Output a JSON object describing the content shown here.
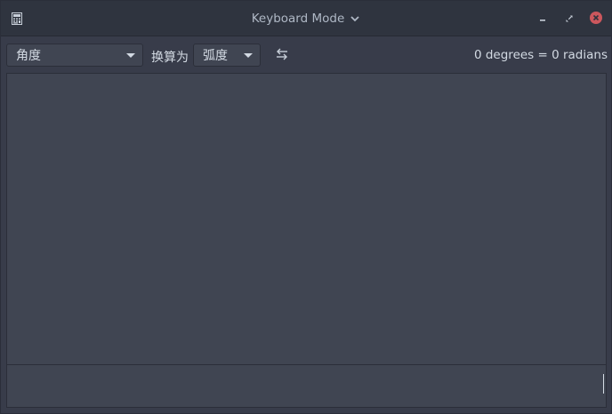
{
  "window": {
    "title": "Keyboard Mode",
    "app_icon": "calculator-icon",
    "controls": {
      "minimize_icon": "minimize-icon",
      "maximize_icon": "restore-icon",
      "close_icon": "close-icon"
    }
  },
  "converter": {
    "from_unit": "角度",
    "convert_to_label": "换算为",
    "to_unit": "弧度",
    "swap_icon": "swap-arrows-icon",
    "result": "0 degrees = 0 radians"
  },
  "entry": {
    "value": ""
  },
  "colors": {
    "titlebar": "#2f343f",
    "background": "#383c4a",
    "panel": "#404552",
    "text": "#d3dae3",
    "close": "#cc575d"
  }
}
